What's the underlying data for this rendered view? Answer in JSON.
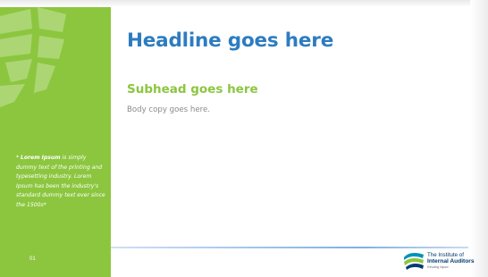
{
  "sidebar": {
    "note_bold": "Lorem Ipsum",
    "note_prefix": "* ",
    "note_rest": " is simply dummy text of the printing and typesetting industry. Lorem Ipsum has been the industry's standard dummy text ever since the 1500s*",
    "page_number": "01"
  },
  "main": {
    "headline": "Headline goes here",
    "subhead": "Subhead goes here",
    "body": "Body copy goes here."
  },
  "logo": {
    "line1": "The Institute of",
    "line2": "Internal Auditors",
    "tagline": "Elevating Impact"
  },
  "colors": {
    "accent_green": "#8cc63f",
    "headline_blue": "#2d7cc0",
    "body_gray": "#8a8a8a",
    "logo_navy": "#003c71"
  }
}
